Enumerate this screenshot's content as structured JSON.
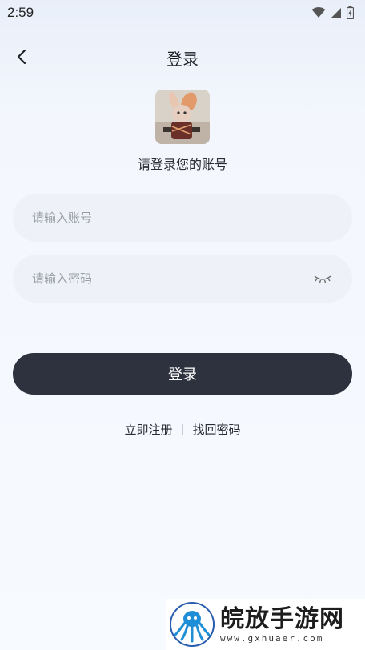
{
  "status_bar": {
    "time": "2:59"
  },
  "header": {
    "title": "登录"
  },
  "main": {
    "subtitle": "请登录您的账号",
    "account_input": {
      "placeholder": "请输入账号",
      "value": ""
    },
    "password_input": {
      "placeholder": "请输入密码",
      "value": ""
    },
    "login_button": "登录",
    "register_link": "立即注册",
    "recover_link": "找回密码"
  },
  "watermark": {
    "title": "皖放手游网",
    "url": "www.gxhuaer.com"
  },
  "colors": {
    "primary_button": "#2e323e",
    "input_bg": "#eef1f7",
    "placeholder": "#9a9ea8"
  }
}
